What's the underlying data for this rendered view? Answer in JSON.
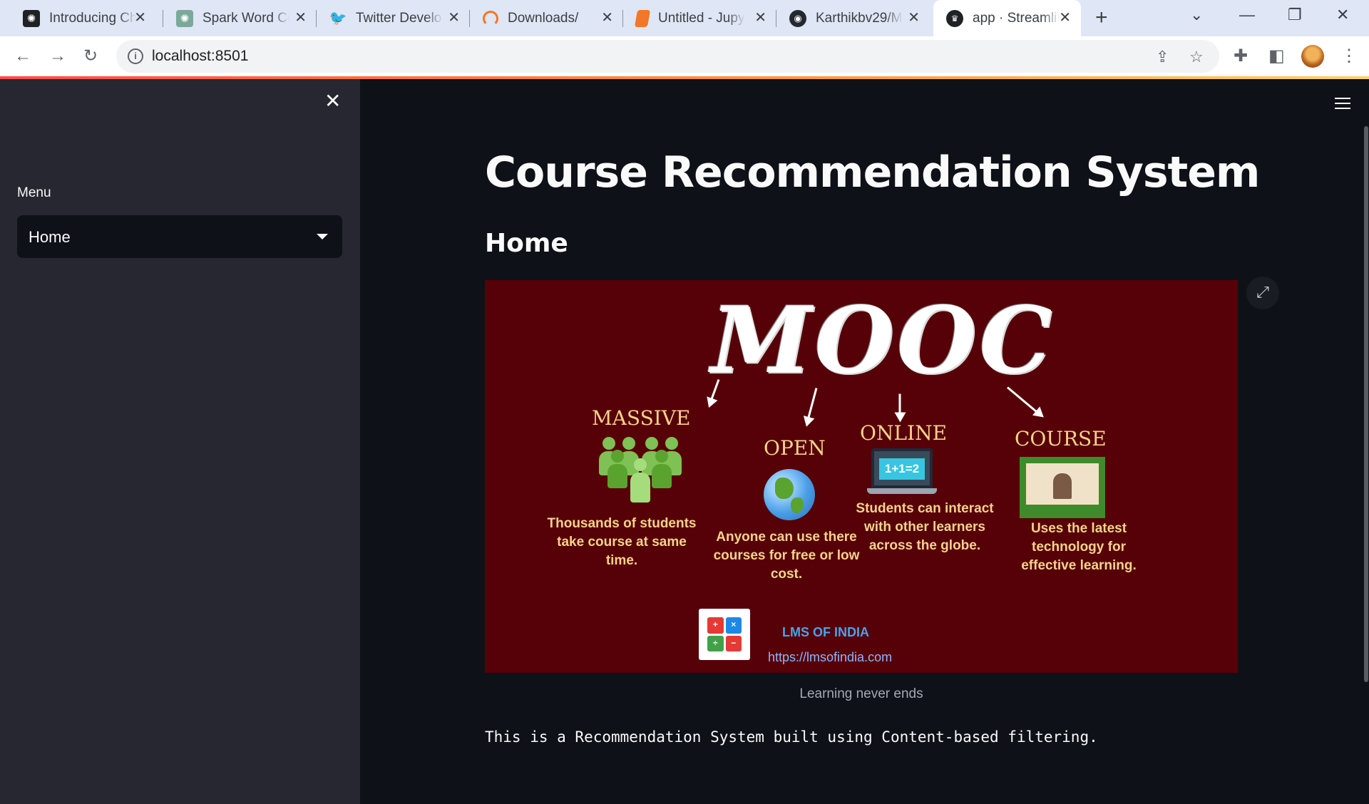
{
  "browser": {
    "tabs": [
      {
        "title": "Introducing Ch",
        "icon": "openai-icon"
      },
      {
        "title": "Spark Word Co",
        "icon": "openai-icon"
      },
      {
        "title": "Twitter Develo",
        "icon": "twitter-icon"
      },
      {
        "title": "Downloads/",
        "icon": "jupyter-icon"
      },
      {
        "title": "Untitled - Jupy",
        "icon": "jupyter-book-icon"
      },
      {
        "title": "Karthikbv29/M",
        "icon": "github-icon"
      },
      {
        "title": "app · Streamlit",
        "icon": "streamlit-icon",
        "active": true
      }
    ],
    "url": "localhost:8501"
  },
  "sidebar": {
    "menu_label": "Menu",
    "selected": "Home"
  },
  "main": {
    "title": "Course Recommendation System",
    "subheader": "Home",
    "image": {
      "headline": "MOOC",
      "pillars": [
        {
          "title": "MASSIVE",
          "desc": "Thousands of students take course at same time."
        },
        {
          "title": "OPEN",
          "desc": "Anyone can use there courses for free or low cost."
        },
        {
          "title": "ONLINE",
          "desc": "Students can interact with other learners across the globe."
        },
        {
          "title": "COURSE",
          "desc": "Uses the latest technology for effective learning."
        }
      ],
      "laptop_text": "1+1=2",
      "brand_name": "LMS OF INDIA",
      "brand_url": "https://lmsofindia.com"
    },
    "caption": "Learning never ends",
    "description": "This is a Recommendation System built using Content-based filtering."
  },
  "colors": {
    "app_bg": "#0e1117",
    "sidebar_bg": "#262730",
    "poster_bg": "#560008",
    "poster_text": "#f6d38a",
    "accent": "#ff4b4b"
  }
}
